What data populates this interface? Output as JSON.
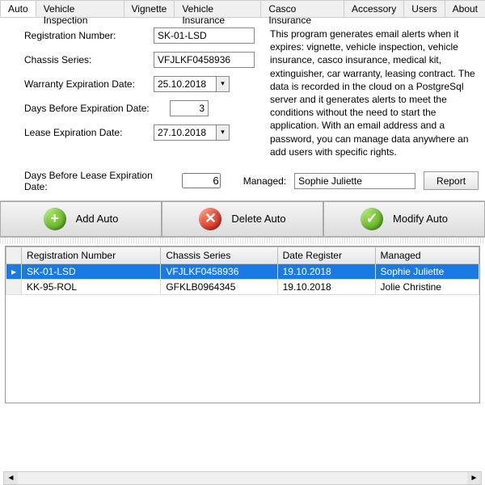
{
  "tabs": [
    "Auto",
    "Vehicle Inspection",
    "Vignette",
    "Vehicle Insurance",
    "Casco Insurance",
    "Accessory",
    "Users",
    "About"
  ],
  "form": {
    "regLabel": "Registration Number:",
    "regValue": "SK-01-LSD",
    "chassisLabel": "Chassis Series:",
    "chassisValue": "VFJLKF0458936",
    "warrantyLabel": "Warranty Expiration Date:",
    "warrantyValue": "25.10.2018",
    "daysBeforeLabel": "Days Before Expiration Date:",
    "daysBeforeValue": "3",
    "leaseLabel": "Lease Expiration Date:",
    "leaseValue": "27.10.2018"
  },
  "description": "This program generates email alerts when it expires: vignette, vehicle inspection, vehicle insurance, casco insurance, medical kit, extinguisher, car warranty, leasing contract. The data is recorded in the cloud on a PostgreSql server and it generates alerts to meet the conditions without the need to start the application. With an email address and a password, you can manage data anywhere an add users with specific rights.",
  "bottom": {
    "daysLeaseLabel": "Days Before Lease Expiration Date:",
    "daysLeaseValue": "6",
    "managedLabel": "Managed:",
    "managedValue": "Sophie Juliette",
    "reportLabel": "Report"
  },
  "buttons": {
    "add": "Add Auto",
    "del": "Delete Auto",
    "mod": "Modify Auto"
  },
  "grid": {
    "headers": [
      "Registration Number",
      "Chassis Series",
      "Date Register",
      "Managed"
    ],
    "rows": [
      {
        "reg": "SK-01-LSD",
        "chassis": "VFJLKF0458936",
        "date": "19.10.2018",
        "mgr": "Sophie Juliette",
        "sel": true
      },
      {
        "reg": "KK-95-ROL",
        "chassis": "GFKLB0964345",
        "date": "19.10.2018",
        "mgr": "Jolie Christine",
        "sel": false
      }
    ]
  },
  "icons": {
    "dropdown": "▾",
    "plus": "+",
    "x": "✕",
    "check": "✓",
    "left": "◄",
    "right": "►",
    "marker": "▸"
  }
}
